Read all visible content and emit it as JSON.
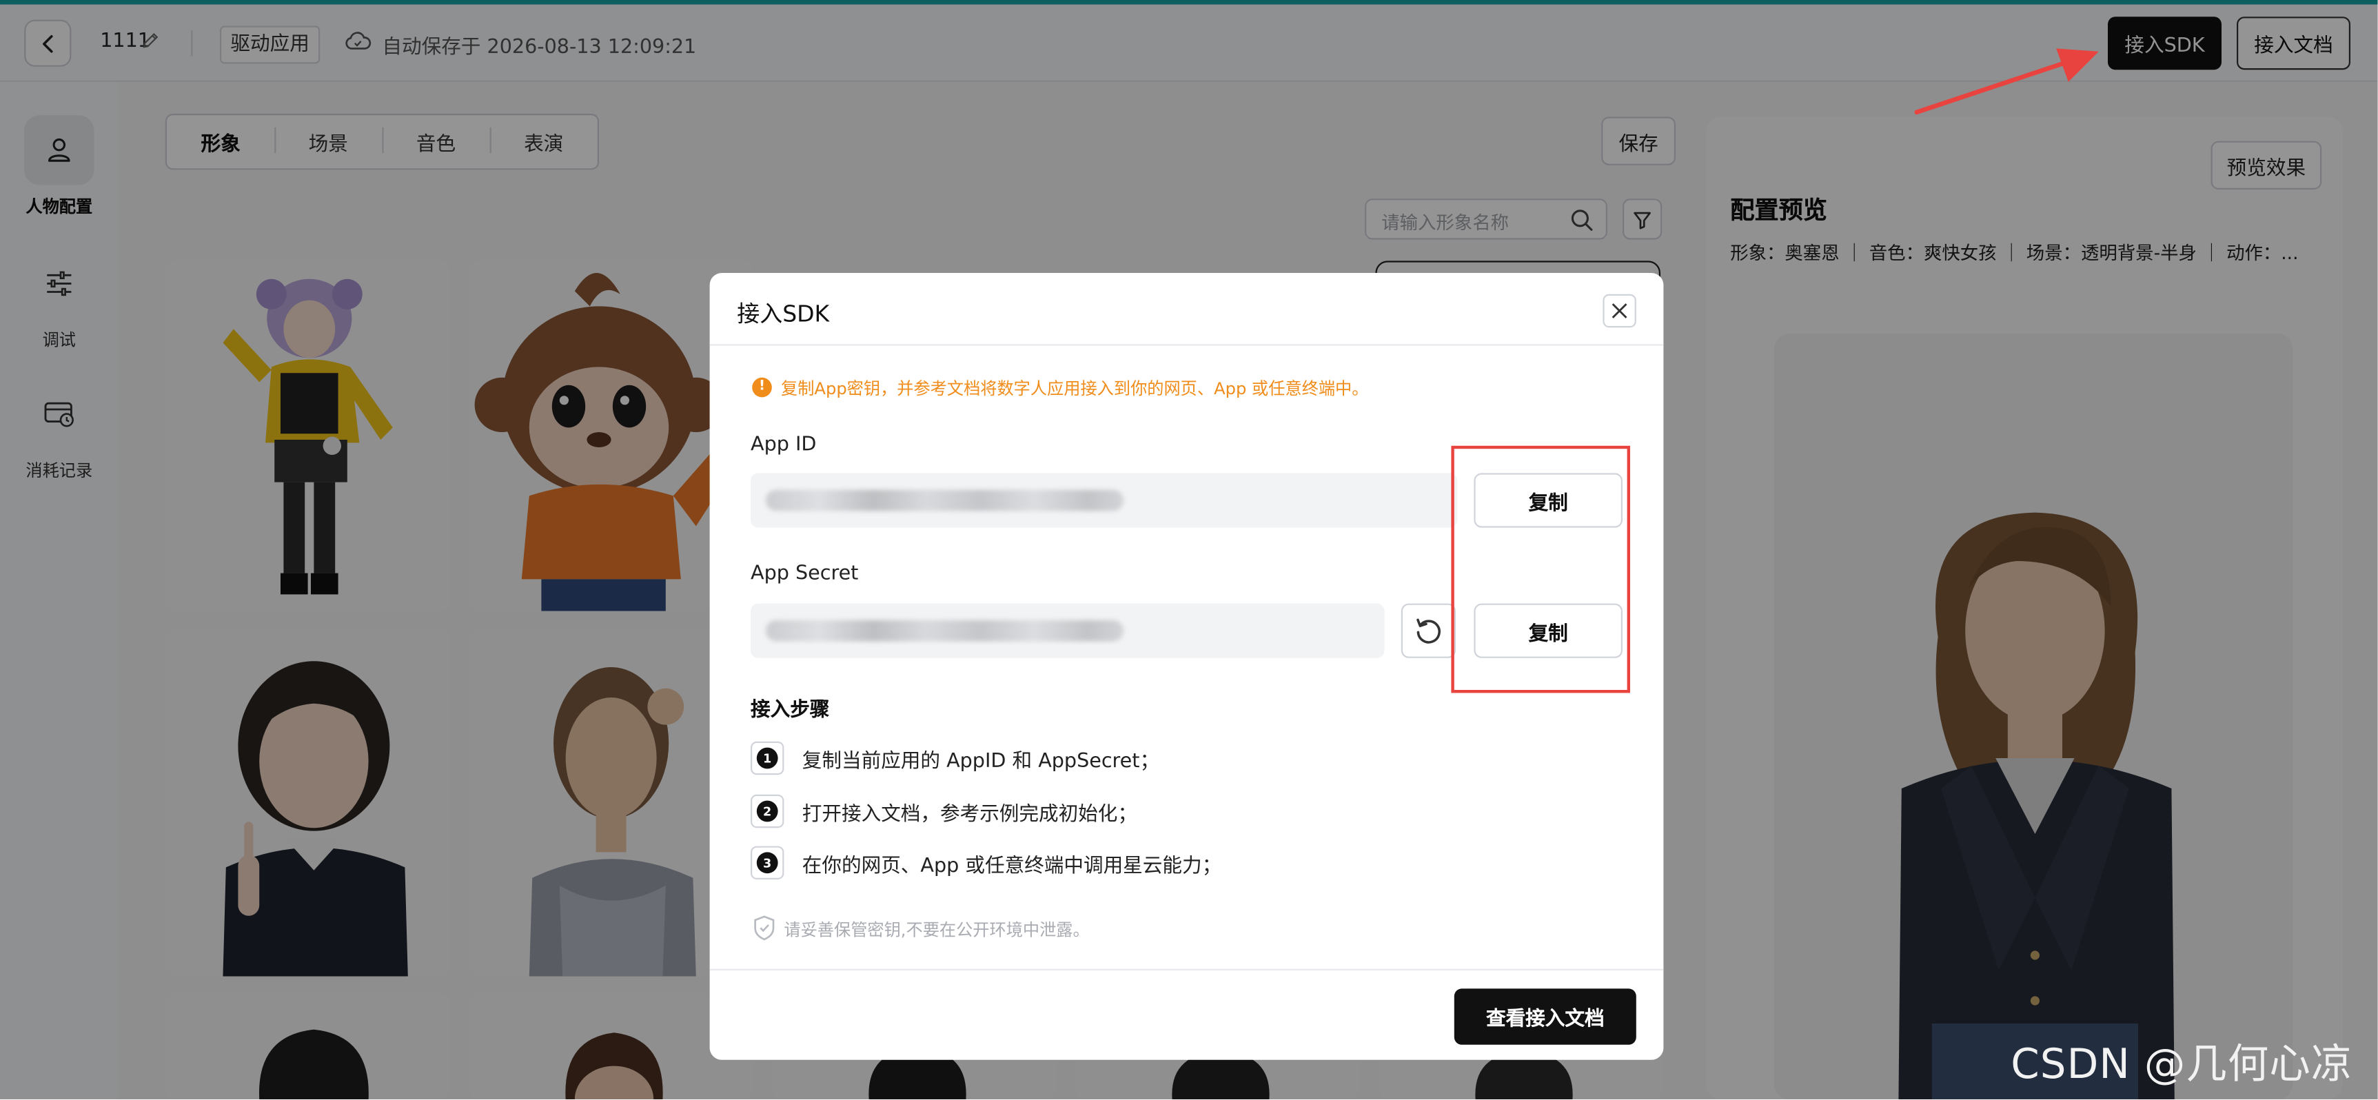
{
  "header": {
    "app_name": "1111",
    "mode_badge": "驱动应用",
    "autosave_text": "自动保存于 2026-08-13 12:09:21",
    "sdk_button": "接入SDK",
    "docs_button": "接入文档"
  },
  "nav": {
    "items": [
      {
        "label": "人物配置",
        "icon": "person-icon",
        "active": true
      },
      {
        "label": "调试",
        "icon": "sliders-icon",
        "active": false
      },
      {
        "label": "消耗记录",
        "icon": "card-icon",
        "active": false
      }
    ]
  },
  "main": {
    "tabs": [
      {
        "label": "形象",
        "active": true
      },
      {
        "label": "场景",
        "active": false
      },
      {
        "label": "音色",
        "active": false
      },
      {
        "label": "表演",
        "active": false
      }
    ],
    "save_button": "保存",
    "search_placeholder": "请输入形象名称"
  },
  "preview": {
    "button": "预览效果",
    "title": "配置预览",
    "info": "形象：奥塞恩 ｜ 音色：爽快女孩 ｜ 场景：透明背景-半身 ｜ 动作：..."
  },
  "dialog": {
    "title": "接入SDK",
    "warning": "复制App密钥，并参考文档将数字人应用接入到你的网页、App 或任意终端中。",
    "app_id_label": "App ID",
    "app_secret_label": "App Secret",
    "copy_label": "复制",
    "steps_title": "接入步骤",
    "steps": [
      {
        "num": "1",
        "text": "复制当前应用的 AppID 和 AppSecret；"
      },
      {
        "num": "2",
        "text": "打开接入文档，参考示例完成初始化；"
      },
      {
        "num": "3",
        "text": "在你的网页、App 或任意终端中调用星云能力；"
      }
    ],
    "security_note": "请妥善保管密钥,不要在公开环境中泄露。",
    "view_docs_button": "查看接入文档"
  },
  "watermark": "CSDN @几何心凉",
  "colors": {
    "accent": "#1aa3a6",
    "warning": "#f08c1a",
    "annotation_red": "#e8433f",
    "primary_button": "#111111"
  }
}
